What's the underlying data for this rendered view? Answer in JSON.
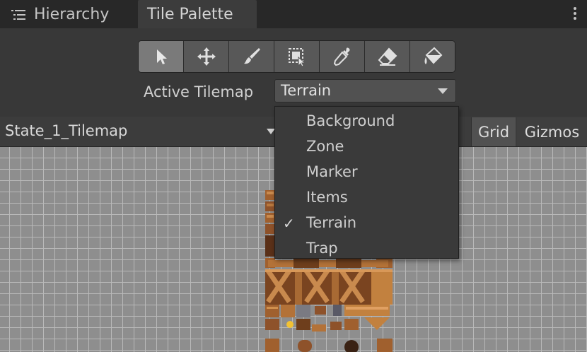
{
  "tabs": {
    "hierarchy": {
      "label": "Hierarchy",
      "icon": "hierarchy-list-icon"
    },
    "tile_palette": {
      "label": "Tile Palette",
      "active": true
    }
  },
  "toolbar": {
    "tools": [
      {
        "name": "select-tool",
        "icon": "arrow-cursor-icon",
        "active": true
      },
      {
        "name": "move-tool",
        "icon": "move-arrows-icon"
      },
      {
        "name": "paint-tool",
        "icon": "paintbrush-icon"
      },
      {
        "name": "box-fill-tool",
        "icon": "box-select-icon"
      },
      {
        "name": "pick-tool",
        "icon": "eyedropper-icon"
      },
      {
        "name": "erase-tool",
        "icon": "eraser-icon"
      },
      {
        "name": "flood-fill-tool",
        "icon": "paint-bucket-icon"
      }
    ]
  },
  "active_tilemap": {
    "label": "Active Tilemap",
    "selected": "Terrain"
  },
  "palette": {
    "name": "State_1_Tilemap",
    "grid_label": "Grid",
    "gizmos_label": "Gizmos"
  },
  "menu": {
    "items": [
      {
        "label": "Background",
        "checked": false
      },
      {
        "label": "Zone",
        "checked": false
      },
      {
        "label": "Marker",
        "checked": false
      },
      {
        "label": "Items",
        "checked": false
      },
      {
        "label": "Terrain",
        "checked": true
      },
      {
        "label": "Trap",
        "checked": false
      }
    ],
    "check_glyph": "✓"
  },
  "colors": {
    "panel": "#383838",
    "tab_bar": "#282828",
    "active_tool": "#7a7a7a",
    "canvas": "#8e8e8e",
    "grid_line": "#b9b9b9",
    "tile_wood": "#b0703a"
  }
}
